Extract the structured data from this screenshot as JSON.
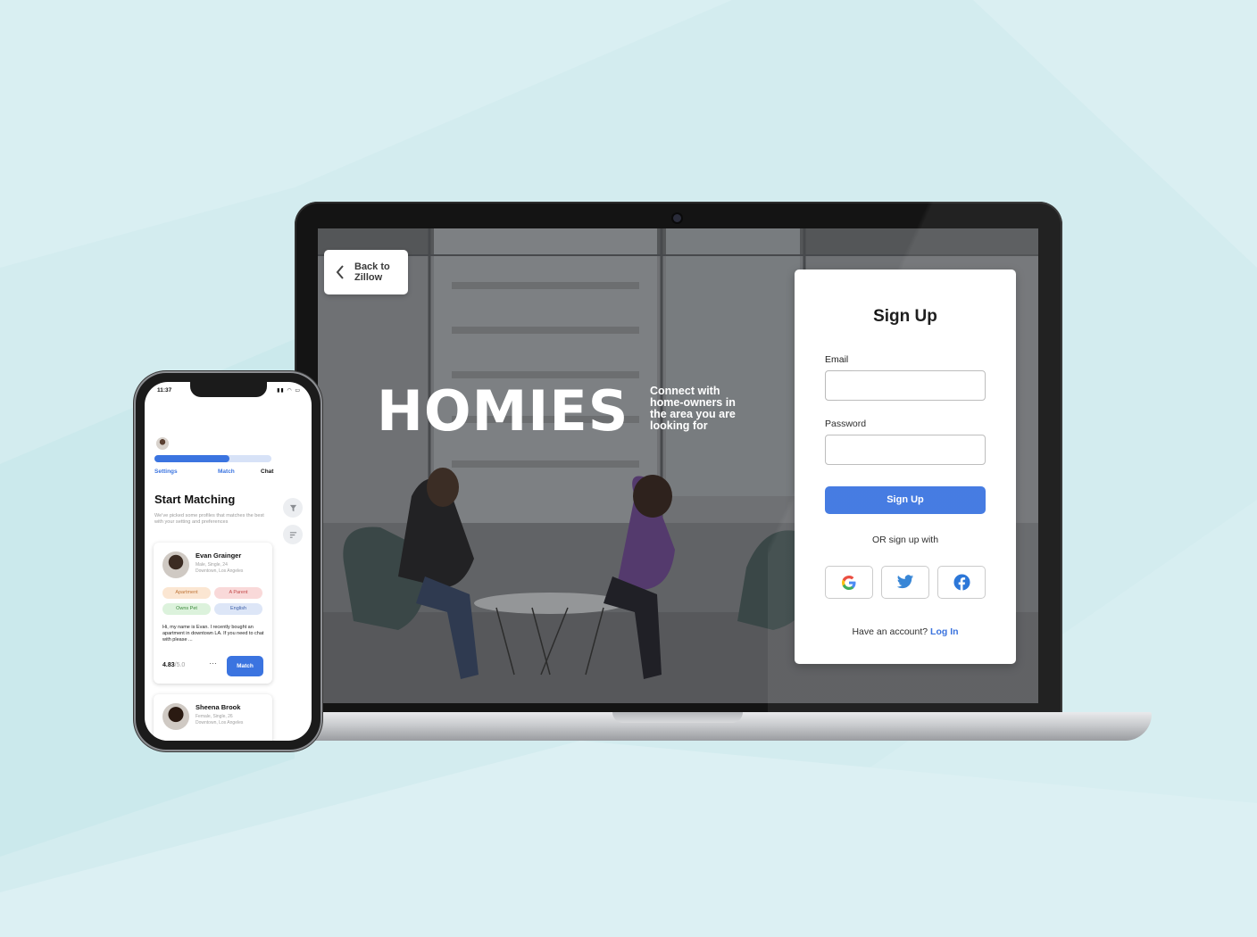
{
  "colors": {
    "background": "#d3ecef",
    "accent": "#3b74e0",
    "link": "#2f6bdc"
  },
  "laptop": {
    "back_button": {
      "label": "Back to Zillow",
      "icon": "chevron-left-icon"
    },
    "brand": "HOMIES",
    "tagline": "Connect with home-owners in the area you are looking for",
    "signup": {
      "title": "Sign Up",
      "email_label": "Email",
      "email_value": "",
      "password_label": "Password",
      "password_value": "",
      "submit_label": "Sign Up",
      "or_text": "OR sign up with",
      "social": [
        "google-icon",
        "twitter-icon",
        "facebook-icon"
      ],
      "account_prompt": "Have an account?",
      "login_link": "Log In"
    }
  },
  "phone": {
    "status_time": "11:37",
    "progress": 0.64,
    "steps": [
      {
        "label": "Settings",
        "color": "#3b74e0"
      },
      {
        "label": "Match",
        "color": "#3b74e0"
      },
      {
        "label": "Chat",
        "color": "#111111"
      }
    ],
    "title": "Start Matching",
    "subtitle": "We've picked some profiles that matches the best with your setting and preferences",
    "profiles": [
      {
        "name": "Evan Grainger",
        "meta_line1": "Male, Single, 24",
        "meta_line2": "Downtown, Los Angeles",
        "tags": [
          {
            "label": "Apartment",
            "bg": "#fbe6d2",
            "fg": "#c0773a"
          },
          {
            "label": "A Parent",
            "bg": "#f9d9d9",
            "fg": "#c44a4a"
          },
          {
            "label": "Owns Pet",
            "bg": "#dcf2dc",
            "fg": "#3d8a3d"
          },
          {
            "label": "English",
            "bg": "#dde6f7",
            "fg": "#3b5ea8"
          }
        ],
        "bio": "Hi, my name is Evan. I recently bought an apartment in downtown LA. If you need to chat with please ...",
        "rating": "4.83",
        "rating_max": "/5.0",
        "more": "···",
        "action_label": "Match"
      },
      {
        "name": "Sheena Brook",
        "meta_line1": "Female, Single, 26",
        "meta_line2": "Downtown, Los Angeles"
      }
    ]
  }
}
